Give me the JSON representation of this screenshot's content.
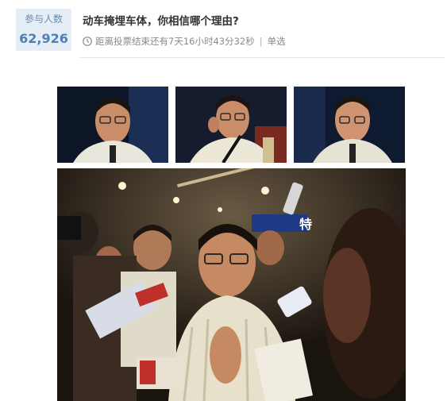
{
  "poll": {
    "participants_label": "参与人数",
    "participants_count": "62,926",
    "title": "动车掩埋车体，你相信哪个理由?",
    "deadline": "距离投票结束还有7天16小时43分32秒",
    "separator": "|",
    "vote_type": "单选"
  },
  "photos": {
    "top": [
      {
        "name": "spokesman-photo-1"
      },
      {
        "name": "spokesman-photo-2"
      },
      {
        "name": "spokesman-photo-3"
      }
    ],
    "bottom": {
      "name": "press-conference-photo",
      "sign_text": "特"
    }
  },
  "colors": {
    "count_bg": "#e5eef6",
    "count_value": "#4e7fb6",
    "title": "#333333",
    "meta": "#8a8a8a"
  }
}
